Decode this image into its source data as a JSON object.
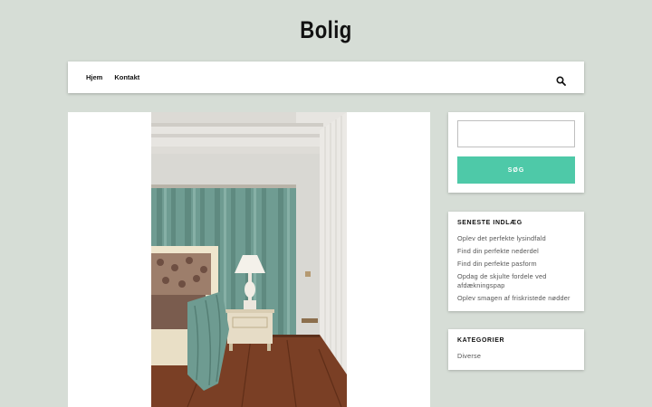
{
  "site": {
    "title": "Bolig"
  },
  "nav": {
    "items": [
      {
        "label": "Hjem"
      },
      {
        "label": "Kontakt"
      }
    ]
  },
  "search": {
    "button_label": "SØG",
    "placeholder": ""
  },
  "recent_posts": {
    "title": "SENESTE INDLÆG",
    "items": [
      {
        "label": "Oplev det perfekte lysindfald"
      },
      {
        "label": "Find din perfekte nederdel"
      },
      {
        "label": "Find din perfekte pasform"
      },
      {
        "label": "Opdag de skjulte fordele ved afdækningspap"
      },
      {
        "label": "Oplev smagen af friskristede nødder"
      }
    ]
  },
  "categories": {
    "title": "KATEGORIER",
    "items": [
      {
        "label": "Diverse"
      }
    ]
  },
  "colors": {
    "page_bg": "#d6ddd6",
    "accent": "#4ec9a8",
    "curtain": "#6f9c92"
  },
  "icons": {
    "search": "search-icon"
  }
}
